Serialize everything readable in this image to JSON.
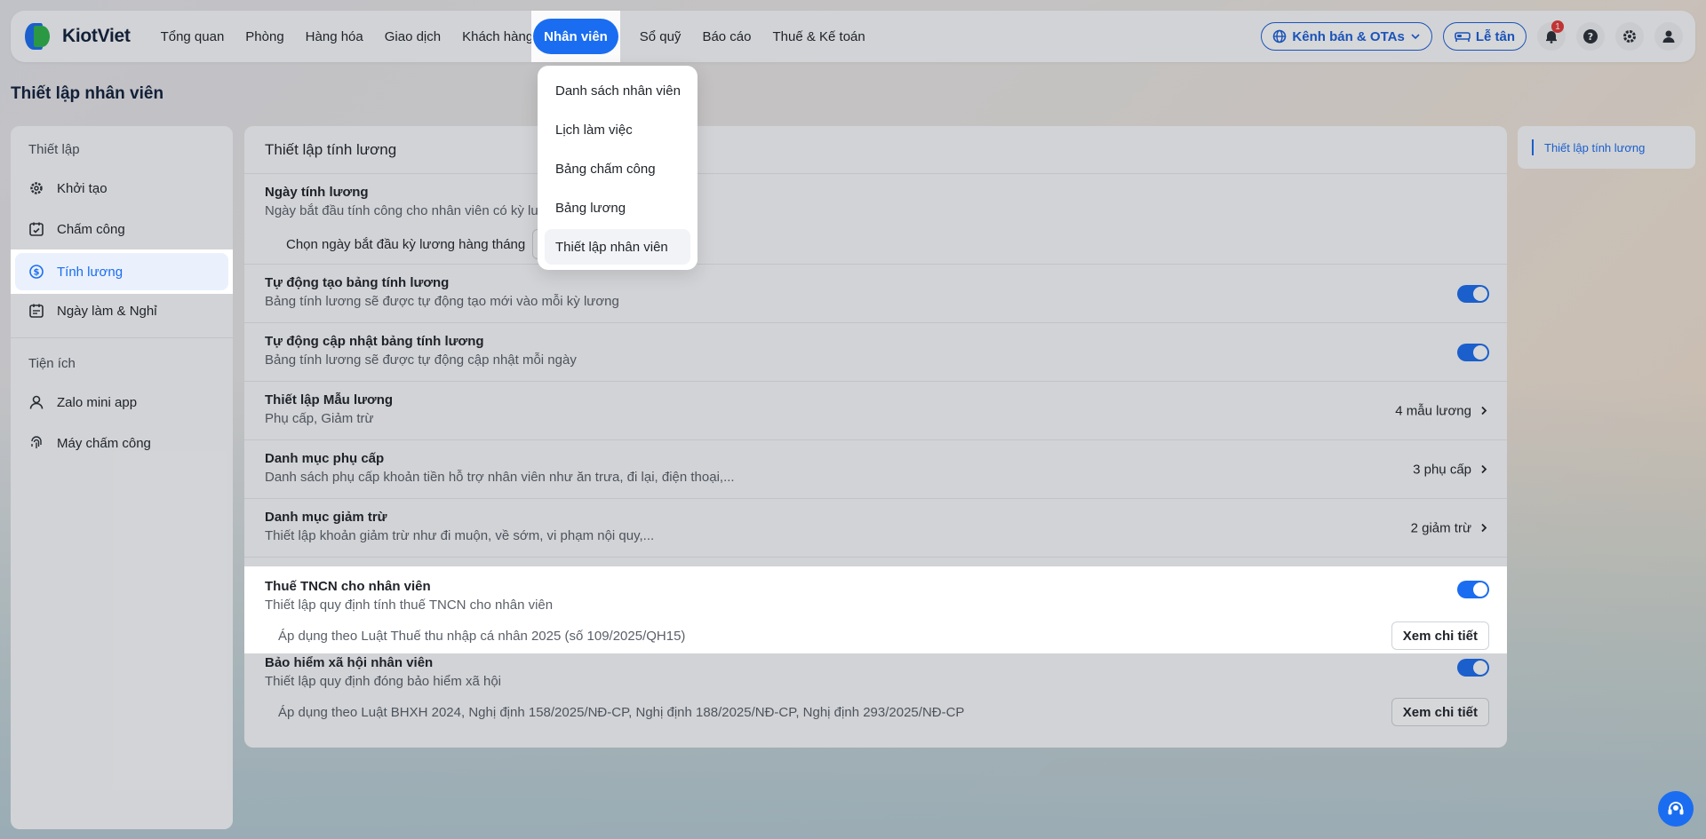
{
  "nav": {
    "logo_text": "KiotViet",
    "items": [
      "Tổng quan",
      "Phòng",
      "Hàng hóa",
      "Giao dịch",
      "Khách hàng"
    ],
    "active_item": "Nhân viên",
    "items_after": [
      "Sổ quỹ",
      "Báo cáo",
      "Thuế & Kế toán"
    ],
    "channel_button": "Kênh bán & OTAs",
    "reception_button": "Lễ tân",
    "notification_count": "1"
  },
  "dropdown": {
    "items": [
      "Danh sách nhân viên",
      "Lịch làm việc",
      "Bảng chấm công",
      "Bảng lương",
      "Thiết lập nhân viên"
    ]
  },
  "page_title": "Thiết lập nhân viên",
  "sidebar": {
    "heading_setup": "Thiết lập",
    "setup_items": [
      "Khởi tạo",
      "Chấm công",
      "Tính lương",
      "Ngày làm & Nghỉ"
    ],
    "heading_utils": "Tiện ích",
    "util_items": [
      "Zalo mini app",
      "Máy chấm công"
    ]
  },
  "main": {
    "title": "Thiết lập tính lương",
    "pay_day": {
      "title": "Ngày tính lương",
      "desc": "Ngày bắt đầu tính công cho nhân viên có kỳ lư",
      "select_label": "Chọn ngày bắt đầu kỳ lương hàng tháng"
    },
    "rows": [
      {
        "title": "Tự động tạo bảng tính lương",
        "desc": "Bảng tính lương sẽ được tự động tạo mới vào mỗi kỳ lương"
      },
      {
        "title": "Tự động cập nhật bảng tính lương",
        "desc": "Bảng tính lương sẽ được tự động cập nhật mỗi ngày"
      },
      {
        "title": "Thiết lập Mẫu lương",
        "desc": "Phụ cấp, Giảm trừ",
        "right": "4 mẫu lương"
      },
      {
        "title": "Danh mục phụ cấp",
        "desc": "Danh sách phụ cấp khoản tiền hỗ trợ nhân viên như ăn trưa, đi lại, điện thoại,...",
        "right": "3 phụ cấp"
      },
      {
        "title": "Danh mục giảm trừ",
        "desc": "Thiết lập khoản giảm trừ như đi muộn, về sớm, vi phạm nội quy,...",
        "right": "2 giảm trừ"
      }
    ],
    "tncn": {
      "title": "Thuế TNCN cho nhân viên",
      "desc": "Thiết lập quy định tính thuế TNCN cho nhân viên",
      "note": "Áp dụng theo Luật Thuế thu nhập cá nhân 2025 (số 109/2025/QH15)",
      "button": "Xem chi tiết"
    },
    "bhxh": {
      "title": "Bảo hiểm xã hội nhân viên",
      "desc": "Thiết lập quy định đóng bảo hiểm xã hội",
      "note": "Áp dụng theo Luật BHXH 2024, Nghị định 158/2025/NĐ-CP, Nghị định 188/2025/NĐ-CP, Nghị định 293/2025/NĐ-CP",
      "button": "Xem chi tiết"
    }
  },
  "anchor": {
    "link": "Thiết lập tính lương"
  },
  "colors": {
    "accent": "#1a6df0"
  }
}
